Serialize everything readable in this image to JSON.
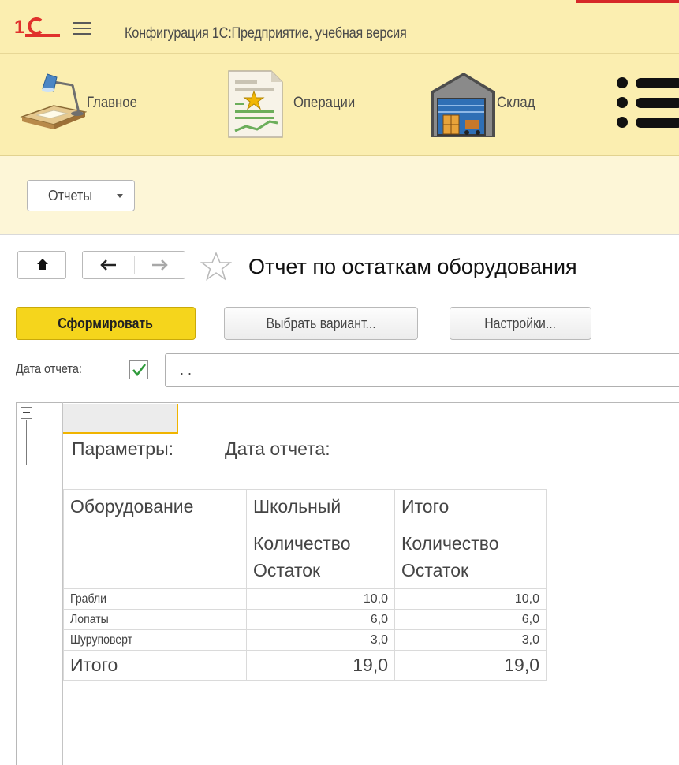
{
  "app": {
    "title": "Конфигурация 1С:Предприятие, учебная версия"
  },
  "sections": [
    {
      "label": "Главное",
      "icon": "desk-lamp-icon"
    },
    {
      "label": "Операции",
      "icon": "operations-document-icon"
    },
    {
      "label": "Склад",
      "icon": "warehouse-icon"
    },
    {
      "icon": "all-functions-menu-icon"
    }
  ],
  "toolbar": {
    "reports_label": "Отчеты"
  },
  "form": {
    "title": "Отчет по остаткам оборудования",
    "generate_label": "Сформировать",
    "variant_label": "Выбрать вариант...",
    "settings_label": "Настройки...",
    "date_label": "Дата отчета:",
    "date_checked": true,
    "date_value": ". ."
  },
  "report": {
    "params_label": "Параметры:",
    "params_value": "Дата отчета:",
    "headers": {
      "col1": "Оборудование",
      "col2": "Школьный",
      "col3": "Итого",
      "sub2_line1": "Количество",
      "sub2_line2": "Остаток",
      "sub3_line1": "Количество",
      "sub3_line2": "Остаток"
    },
    "rows": [
      {
        "name": "Грабли",
        "school": "10,0",
        "total": "10,0"
      },
      {
        "name": "Лопаты",
        "school": "6,0",
        "total": "6,0"
      },
      {
        "name": "Шуруповерт",
        "school": "3,0",
        "total": "3,0"
      }
    ],
    "total_row": {
      "name": "Итого",
      "school": "19,0",
      "total": "19,0"
    }
  },
  "colors": {
    "panel_bg": "#fbeeb0",
    "primary_button": "#f5d51c",
    "check_color": "#2f9a3b",
    "logo_red": "#e0312c"
  }
}
